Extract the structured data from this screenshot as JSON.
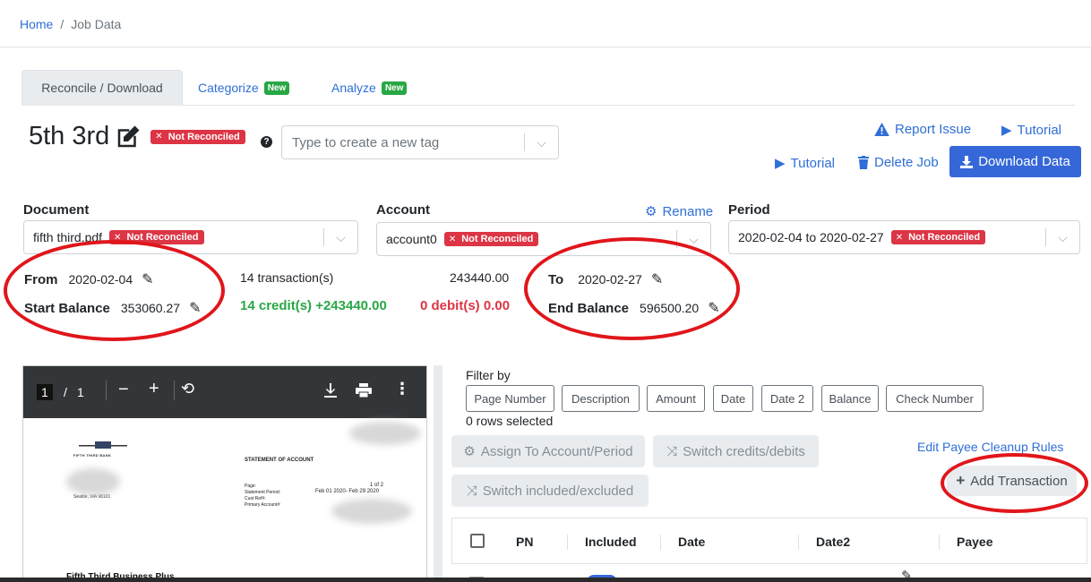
{
  "breadcrumb": {
    "home": "Home",
    "separator": "/",
    "current": "Job Data"
  },
  "tabs": [
    {
      "label": "Reconcile / Download",
      "active": true
    },
    {
      "label": "Categorize",
      "badge": "New"
    },
    {
      "label": "Analyze",
      "badge": "New"
    }
  ],
  "job": {
    "title": "5th 3rd",
    "status": "Not Reconciled",
    "help": "?",
    "tag_placeholder": "Type to create a new tag"
  },
  "actions": {
    "report_issue": "Report Issue",
    "tutorial_top": "Tutorial",
    "tutorial": "Tutorial",
    "delete_job": "Delete Job",
    "download_data": "Download Data"
  },
  "document": {
    "label": "Document",
    "value": "fifth third.pdf",
    "status": "Not Reconciled"
  },
  "account": {
    "label": "Account",
    "rename": "Rename",
    "value": "account0",
    "status": "Not Reconciled"
  },
  "period": {
    "label": "Period",
    "value": "2020-02-04 to 2020-02-27",
    "status": "Not Reconciled"
  },
  "summary": {
    "from_label": "From",
    "from_value": "2020-02-04",
    "start_label": "Start Balance",
    "start_value": "353060.27",
    "transactions": "14 transaction(s)",
    "total": "243440.00",
    "credits": "14 credit(s) +243440.00",
    "debits": "0 debit(s) 0.00",
    "to_label": "To",
    "to_value": "2020-02-27",
    "end_label": "End Balance",
    "end_value": "596500.20"
  },
  "pdf": {
    "page_current": "1",
    "page_sep": "/",
    "page_total": "1",
    "bank_name": "FIFTH THIRD BANK",
    "heading": "STATEMENT OF ACCOUNT",
    "page_lbl": "Page:",
    "page_val": "1 of 2",
    "period_lbl": "Statement Period:",
    "period_val": "Feb 01 2020- Feb 29 2020",
    "cust_lbl": "Cust Ref#:",
    "primary_lbl": "Primary Account#:",
    "address": "Seattle, WA 98101",
    "product": "Fifth Third Business Plus"
  },
  "filter": {
    "label": "Filter by",
    "options": [
      "Page Number",
      "Description",
      "Amount",
      "Date",
      "Date 2",
      "Balance",
      "Check Number"
    ],
    "rows_selected": "0 rows selected"
  },
  "toolbar": {
    "assign": "Assign To Account/Period",
    "switch_cd": "Switch credits/debits",
    "switch_ie": "Switch included/excluded",
    "edit_payee": "Edit Payee Cleanup Rules",
    "add_transaction": "Add Transaction"
  },
  "table": {
    "columns": [
      "PN",
      "Included",
      "Date",
      "Date2",
      "Payee"
    ]
  },
  "colors": {
    "accent": "#3567d8",
    "danger": "#dc3545",
    "success": "#28a745",
    "annotation": "#e0161b"
  }
}
